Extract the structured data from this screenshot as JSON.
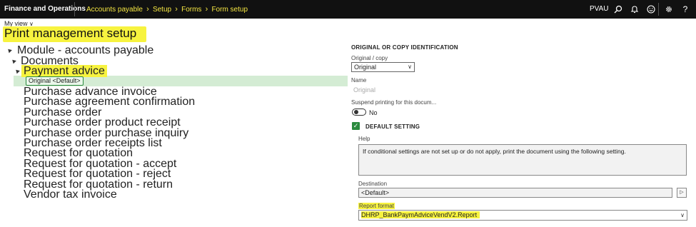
{
  "topbar": {
    "brand": "Finance and Operations",
    "breadcrumbs": [
      "Accounts payable",
      "Setup",
      "Forms",
      "Form setup"
    ],
    "company": "PVAU",
    "icons": [
      "search-icon",
      "bell-icon",
      "smiley-icon",
      "gear-icon",
      "help-icon"
    ]
  },
  "view": {
    "label": "My view"
  },
  "page": {
    "title": "Print management setup"
  },
  "tree": {
    "module": "Module - accounts payable",
    "documents": "Documents",
    "payment_advice": "Payment advice",
    "selected": "Original <Default>",
    "items": [
      "Purchase advance invoice",
      "Purchase agreement confirmation",
      "Purchase order",
      "Purchase order product receipt",
      "Purchase order purchase inquiry",
      "Purchase order receipts list",
      "Request for quotation",
      "Request for quotation - accept",
      "Request for quotation - reject",
      "Request for quotation - return",
      "Vendor tax invoice"
    ]
  },
  "details": {
    "section_title": "ORIGINAL OR COPY IDENTIFICATION",
    "original_copy_label": "Original / copy",
    "original_copy_value": "Original",
    "name_label": "Name",
    "name_value": "Original",
    "suspend_label": "Suspend printing for this docum...",
    "suspend_value": "No",
    "default_setting_label": "DEFAULT SETTING",
    "help_label": "Help",
    "help_text": "If conditional settings are not set up or do not apply, print the document using the following setting.",
    "destination_label": "Destination",
    "destination_value": "<Default>",
    "report_format_label": "Report format",
    "report_format_value": "DHRP_BankPaymAdviceVendV2.Report",
    "highlight_color": "#f7f33f",
    "accent_color": "#2b8a3e"
  }
}
